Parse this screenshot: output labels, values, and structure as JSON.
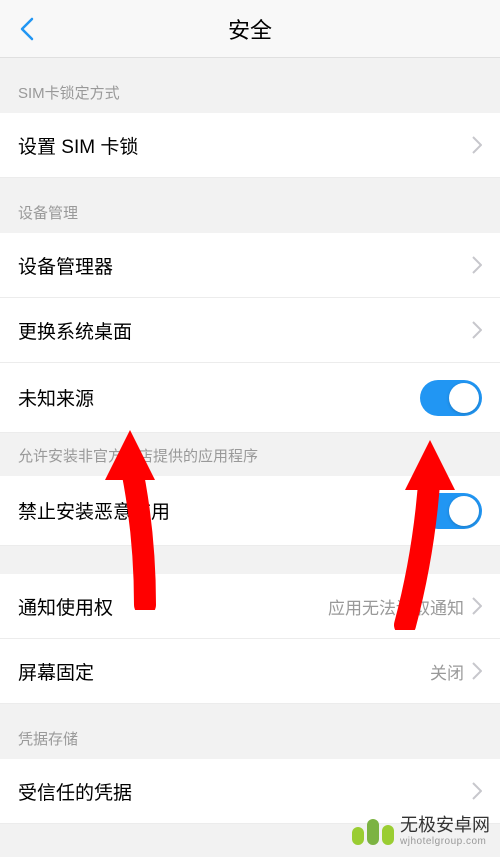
{
  "header": {
    "title": "安全"
  },
  "sections": {
    "sim": {
      "label": "SIM卡锁定方式",
      "item": "设置 SIM 卡锁"
    },
    "device": {
      "label": "设备管理",
      "manager": "设备管理器",
      "launcher": "更换系统桌面",
      "unknown_sources": "未知来源",
      "unknown_sources_hint": "允许安装非官方商店提供的应用程序",
      "block_malware": "禁止安装恶意应用",
      "notification_access": "通知使用权",
      "notification_value": "应用无法读取通知",
      "screen_pinning": "屏幕固定",
      "screen_pinning_value": "关闭"
    },
    "credentials": {
      "label": "凭据存储",
      "trusted": "受信任的凭据"
    }
  },
  "toggles": {
    "unknown_sources": true,
    "block_malware": true
  },
  "watermark": {
    "text": "无极安卓网",
    "url": "wjhotelgroup.com"
  },
  "colors": {
    "accent": "#2196f3",
    "arrow": "#ff0000"
  }
}
